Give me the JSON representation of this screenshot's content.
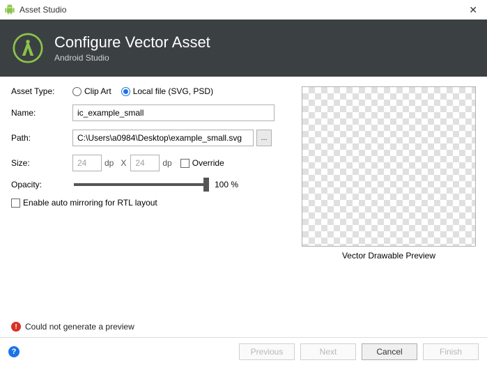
{
  "window": {
    "title": "Asset Studio"
  },
  "banner": {
    "heading": "Configure Vector Asset",
    "subtitle": "Android Studio"
  },
  "form": {
    "assetType": {
      "label": "Asset Type:",
      "clipArt": "Clip Art",
      "localFile": "Local file (SVG, PSD)",
      "selected": "localFile"
    },
    "name": {
      "label": "Name:",
      "value": "ic_example_small"
    },
    "path": {
      "label": "Path:",
      "value": "C:\\Users\\a0984\\Desktop\\example_small.svg",
      "browse": "..."
    },
    "size": {
      "label": "Size:",
      "width": "24",
      "height": "24",
      "unit": "dp",
      "sep": "X",
      "override": "Override"
    },
    "opacity": {
      "label": "Opacity:",
      "pct": 100,
      "text": "100 %"
    },
    "rtl": {
      "label": "Enable auto mirroring for RTL layout",
      "checked": false
    }
  },
  "preview": {
    "caption": "Vector Drawable Preview"
  },
  "error": {
    "text": "Could not generate a preview"
  },
  "buttons": {
    "previous": "Previous",
    "next": "Next",
    "cancel": "Cancel",
    "finish": "Finish"
  }
}
